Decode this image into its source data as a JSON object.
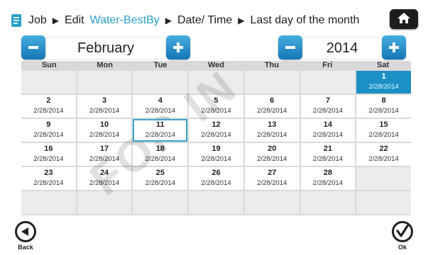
{
  "breadcrumb": {
    "items": [
      {
        "label": "Job",
        "active": false
      },
      {
        "label": "Edit",
        "active": false
      },
      {
        "label": "Water-BestBy",
        "active": true
      },
      {
        "label": "Date/ Time",
        "active": false
      },
      {
        "label": "Last day of the month",
        "active": false
      }
    ]
  },
  "month_selector": {
    "value": "February"
  },
  "year_selector": {
    "value": "2014"
  },
  "calendar": {
    "weekdays": [
      "Sun",
      "Mon",
      "Tue",
      "Wed",
      "Thu",
      "Fri",
      "Sat"
    ],
    "selected_day": "1",
    "highlighted_day": "11",
    "rows": [
      [
        {
          "day": "",
          "date": ""
        },
        {
          "day": "",
          "date": ""
        },
        {
          "day": "",
          "date": ""
        },
        {
          "day": "",
          "date": ""
        },
        {
          "day": "",
          "date": ""
        },
        {
          "day": "",
          "date": ""
        },
        {
          "day": "1",
          "date": "2/28/2014"
        }
      ],
      [
        {
          "day": "2",
          "date": "2/28/2014"
        },
        {
          "day": "3",
          "date": "2/28/2014"
        },
        {
          "day": "4",
          "date": "2/28/2014"
        },
        {
          "day": "5",
          "date": "2/28/2014"
        },
        {
          "day": "6",
          "date": "2/28/2014"
        },
        {
          "day": "7",
          "date": "2/28/2014"
        },
        {
          "day": "8",
          "date": "2/28/2014"
        }
      ],
      [
        {
          "day": "9",
          "date": "2/28/2014"
        },
        {
          "day": "10",
          "date": "2/28/2014"
        },
        {
          "day": "11",
          "date": "2/28/2014"
        },
        {
          "day": "12",
          "date": "2/28/2014"
        },
        {
          "day": "13",
          "date": "2/28/2014"
        },
        {
          "day": "14",
          "date": "2/28/2014"
        },
        {
          "day": "15",
          "date": "2/28/2014"
        }
      ],
      [
        {
          "day": "16",
          "date": "2/28/2014"
        },
        {
          "day": "17",
          "date": "2/28/2014"
        },
        {
          "day": "18",
          "date": "2/28/2014"
        },
        {
          "day": "19",
          "date": "2/28/2014"
        },
        {
          "day": "20",
          "date": "2/28/2014"
        },
        {
          "day": "21",
          "date": "2/28/2014"
        },
        {
          "day": "22",
          "date": "2/28/2014"
        }
      ],
      [
        {
          "day": "23",
          "date": "2/28/2014"
        },
        {
          "day": "24",
          "date": "2/28/2014"
        },
        {
          "day": "25",
          "date": "2/28/2014"
        },
        {
          "day": "26",
          "date": "2/28/2014"
        },
        {
          "day": "27",
          "date": "2/28/2014"
        },
        {
          "day": "28",
          "date": "2/28/2014"
        },
        {
          "day": "",
          "date": ""
        }
      ],
      [
        {
          "day": "",
          "date": ""
        },
        {
          "day": "",
          "date": ""
        },
        {
          "day": "",
          "date": ""
        },
        {
          "day": "",
          "date": ""
        },
        {
          "day": "",
          "date": ""
        },
        {
          "day": "",
          "date": ""
        },
        {
          "day": "",
          "date": ""
        }
      ]
    ]
  },
  "footer": {
    "back_label": "Back",
    "ok_label": "Ok"
  },
  "watermark": {
    "text": "FOR IN"
  },
  "icons": {
    "doc": "document-icon",
    "home": "home-icon",
    "minus": "minus-icon",
    "plus": "plus-icon",
    "back": "back-arrow-icon",
    "ok": "checkmark-icon"
  },
  "colors": {
    "accent": "#2aa0c8",
    "button_blue": "#1676b8",
    "selected_cell": "#1a90c4",
    "home_btn": "#1d1d1d"
  }
}
